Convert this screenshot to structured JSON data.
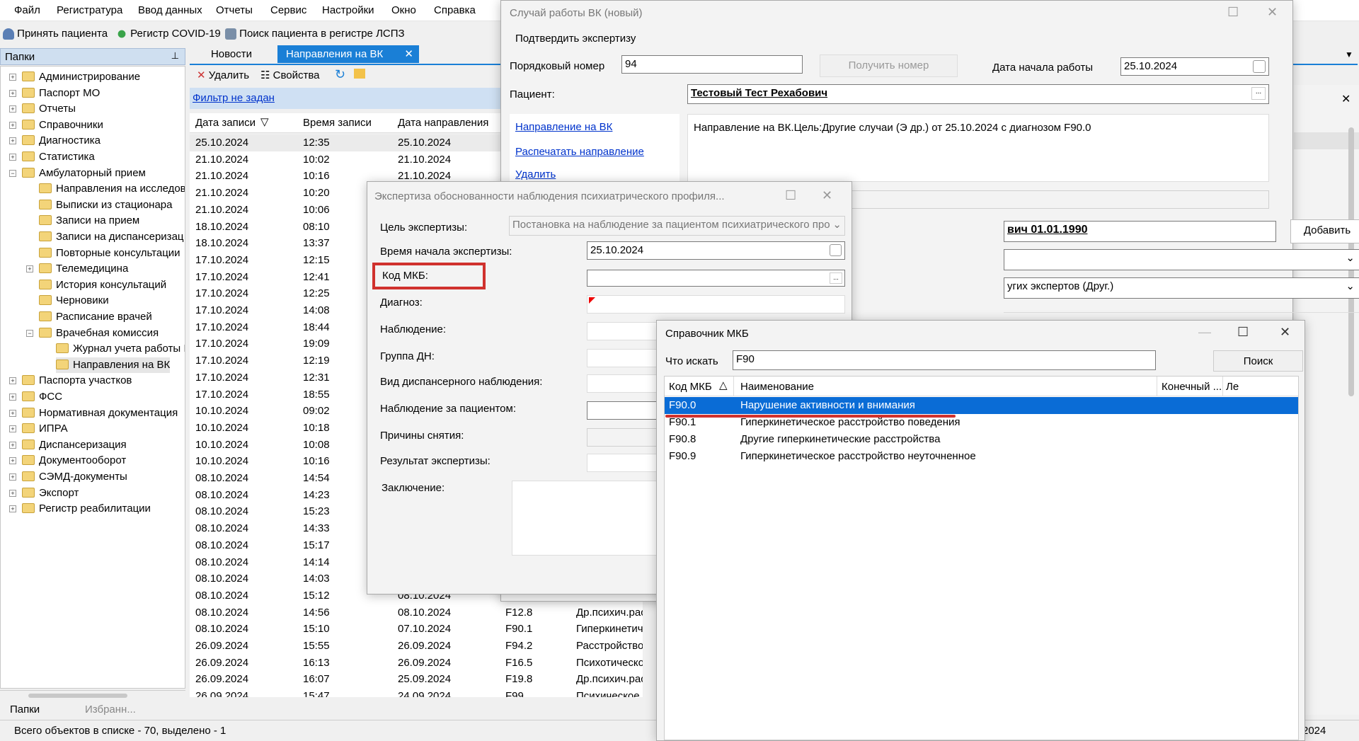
{
  "menu": [
    "Файл",
    "Регистратура",
    "Ввод данных",
    "Отчеты",
    "Сервис",
    "Настройки",
    "Окно",
    "Справка"
  ],
  "toolbar": {
    "accept_patient": "Принять пациента",
    "covid_register": "Регистр COVID-19",
    "search_lspz": "Поиск пациента в регистре ЛСПЗ"
  },
  "folders_header": "Папки",
  "tree": [
    {
      "label": "Администрирование",
      "level": 0,
      "exp": "+"
    },
    {
      "label": "Паспорт МО",
      "level": 0,
      "exp": "+"
    },
    {
      "label": "Отчеты",
      "level": 0,
      "exp": "+"
    },
    {
      "label": "Справочники",
      "level": 0,
      "exp": "+"
    },
    {
      "label": "Диагностика",
      "level": 0,
      "exp": "+"
    },
    {
      "label": "Статистика",
      "level": 0,
      "exp": "+"
    },
    {
      "label": "Амбулаторный прием",
      "level": 0,
      "exp": "−"
    },
    {
      "label": "Направления на исследов",
      "level": 1,
      "exp": ""
    },
    {
      "label": "Выписки из стационара",
      "level": 1,
      "exp": ""
    },
    {
      "label": "Записи на прием",
      "level": 1,
      "exp": ""
    },
    {
      "label": "Записи на диспансеризац",
      "level": 1,
      "exp": ""
    },
    {
      "label": "Повторные консультации",
      "level": 1,
      "exp": ""
    },
    {
      "label": "Телемедицина",
      "level": 1,
      "exp": "+"
    },
    {
      "label": "История консультаций",
      "level": 1,
      "exp": ""
    },
    {
      "label": "Черновики",
      "level": 1,
      "exp": ""
    },
    {
      "label": "Расписание врачей",
      "level": 1,
      "exp": ""
    },
    {
      "label": "Врачебная комиссия",
      "level": 1,
      "exp": "−"
    },
    {
      "label": "Журнал учета работы I",
      "level": 2,
      "exp": ""
    },
    {
      "label": "Направления на ВК",
      "level": 2,
      "exp": ""
    },
    {
      "label": "Паспорта участков",
      "level": 0,
      "exp": "+"
    },
    {
      "label": "ФСС",
      "level": 0,
      "exp": "+"
    },
    {
      "label": "Нормативная документация",
      "level": 0,
      "exp": "+"
    },
    {
      "label": "ИПРА",
      "level": 0,
      "exp": "+"
    },
    {
      "label": "Диспансеризация",
      "level": 0,
      "exp": "+"
    },
    {
      "label": "Документооборот",
      "level": 0,
      "exp": "+"
    },
    {
      "label": "СЭМД-документы",
      "level": 0,
      "exp": "+"
    },
    {
      "label": "Экспорт",
      "level": 0,
      "exp": "+"
    },
    {
      "label": "Регистр реабилитации",
      "level": 0,
      "exp": "+"
    }
  ],
  "bottom_tabs": {
    "folders": "Папки",
    "favorites": "Избранн..."
  },
  "status": {
    "text": "Всего объектов в списке - 70, выделено - 1",
    "right": "2024"
  },
  "tabs": {
    "news": "Новости",
    "referrals": "Направления на ВК"
  },
  "list_toolbar": {
    "delete": "Удалить",
    "properties": "Свойства"
  },
  "filter": "Фильтр не задан",
  "columns": [
    "Дата записи",
    "Время записи",
    "Дата направления"
  ],
  "rows": [
    [
      "25.10.2024",
      "12:35",
      "25.10.2024",
      "",
      ""
    ],
    [
      "21.10.2024",
      "10:02",
      "21.10.2024",
      "",
      ""
    ],
    [
      "21.10.2024",
      "10:16",
      "21.10.2024",
      "",
      ""
    ],
    [
      "21.10.2024",
      "10:20",
      "",
      "",
      ""
    ],
    [
      "21.10.2024",
      "10:06",
      "",
      "",
      ""
    ],
    [
      "18.10.2024",
      "08:10",
      "",
      "",
      ""
    ],
    [
      "18.10.2024",
      "13:37",
      "",
      "",
      ""
    ],
    [
      "17.10.2024",
      "12:15",
      "",
      "",
      ""
    ],
    [
      "17.10.2024",
      "12:41",
      "",
      "",
      ""
    ],
    [
      "17.10.2024",
      "12:25",
      "",
      "",
      ""
    ],
    [
      "17.10.2024",
      "14:08",
      "",
      "",
      ""
    ],
    [
      "17.10.2024",
      "18:44",
      "",
      "",
      ""
    ],
    [
      "17.10.2024",
      "19:09",
      "",
      "",
      ""
    ],
    [
      "17.10.2024",
      "12:19",
      "",
      "",
      ""
    ],
    [
      "17.10.2024",
      "12:31",
      "",
      "",
      ""
    ],
    [
      "17.10.2024",
      "18:55",
      "",
      "",
      ""
    ],
    [
      "10.10.2024",
      "09:02",
      "",
      "",
      ""
    ],
    [
      "10.10.2024",
      "10:18",
      "",
      "",
      ""
    ],
    [
      "10.10.2024",
      "10:08",
      "",
      "",
      ""
    ],
    [
      "10.10.2024",
      "10:16",
      "",
      "",
      ""
    ],
    [
      "08.10.2024",
      "14:54",
      "",
      "",
      ""
    ],
    [
      "08.10.2024",
      "14:23",
      "",
      "",
      ""
    ],
    [
      "08.10.2024",
      "15:23",
      "",
      "",
      ""
    ],
    [
      "08.10.2024",
      "14:33",
      "",
      "",
      ""
    ],
    [
      "08.10.2024",
      "15:17",
      "",
      "",
      ""
    ],
    [
      "08.10.2024",
      "14:14",
      "",
      "",
      ""
    ],
    [
      "08.10.2024",
      "14:03",
      "",
      "",
      ""
    ],
    [
      "08.10.2024",
      "15:12",
      "08.10.2024",
      "",
      ""
    ],
    [
      "08.10.2024",
      "14:56",
      "08.10.2024",
      "F12.8",
      "Др.психич.расс"
    ],
    [
      "08.10.2024",
      "15:10",
      "07.10.2024",
      "F90.1",
      "Гиперкинетичес"
    ],
    [
      "26.09.2024",
      "15:55",
      "26.09.2024",
      "F94.2",
      "Расстройство пр"
    ],
    [
      "26.09.2024",
      "16:13",
      "26.09.2024",
      "F16.5",
      "Психотическое р"
    ],
    [
      "26.09.2024",
      "16:07",
      "25.09.2024",
      "F19.8",
      "Др.психич.расс"
    ],
    [
      "26.09.2024",
      "15:47",
      "24.09.2024",
      "F99",
      "Психическое рас"
    ]
  ],
  "vk_window": {
    "title": "Случай работы ВК (новый)",
    "confirm": "Подтвердить экспертизу",
    "number_label": "Порядковый номер",
    "number_value": "94",
    "get_number": "Получить номер",
    "start_label": "Дата начала работы",
    "start_value": "25.10.2024",
    "patient_label": "Пациент:",
    "patient_value": "Тестовый Тест Рехабович",
    "link_referral": "Направление на ВК",
    "link_print": "Распечатать направление",
    "link_delete": "Удалить",
    "referral_text": "Направление на ВК.Цель:Другие случаи (Э др.) от 25.10.2024 с диагнозом F90.0",
    "person_value": "вич 01.01.1990",
    "add_button": "Добавить",
    "experts_value": "угих экспертов (Друг.)"
  },
  "expertise_window": {
    "title": "Экспертиза обоснованности наблюдения психиатрического профиля...",
    "goal_label": "Цель экспертизы:",
    "goal_value": "Постановка на наблюдение за пациентом психиатрического про",
    "start_label": "Время начала экспертизы:",
    "start_value": "25.10.2024",
    "mkb_label": "Код МКБ:",
    "diagnosis_label": "Диагноз:",
    "observation_label": "Наблюдение:",
    "dn_group_label": "Группа ДН:",
    "disp_type_label": "Вид диспансерного наблюдения:",
    "patient_obs_label": "Наблюдение за пациентом:",
    "removal_label": "Причины снятия:",
    "result_label": "Результат экспертизы:",
    "conclusion_label": "Заключение:"
  },
  "mkb_window": {
    "title": "Справочник МКБ",
    "search_label": "Что искать",
    "search_value": "F90",
    "search_button": "Поиск",
    "columns": [
      "Код МКБ",
      "Наименование",
      "Конечный ...",
      "Ле"
    ],
    "rows": [
      [
        "F90.0",
        "Нарушение активности и внимания"
      ],
      [
        "F90.1",
        "Гиперкинетическое расстройство поведения"
      ],
      [
        "F90.8",
        "Другие гиперкинетические расстройства"
      ],
      [
        "F90.9",
        "Гиперкинетическое расстройство неуточненное"
      ]
    ]
  },
  "colors": {
    "selection": "#0a6cd6",
    "highlight_box": "#d0312d",
    "link": "#0033cc",
    "tab_active": "#1a7fd6"
  }
}
